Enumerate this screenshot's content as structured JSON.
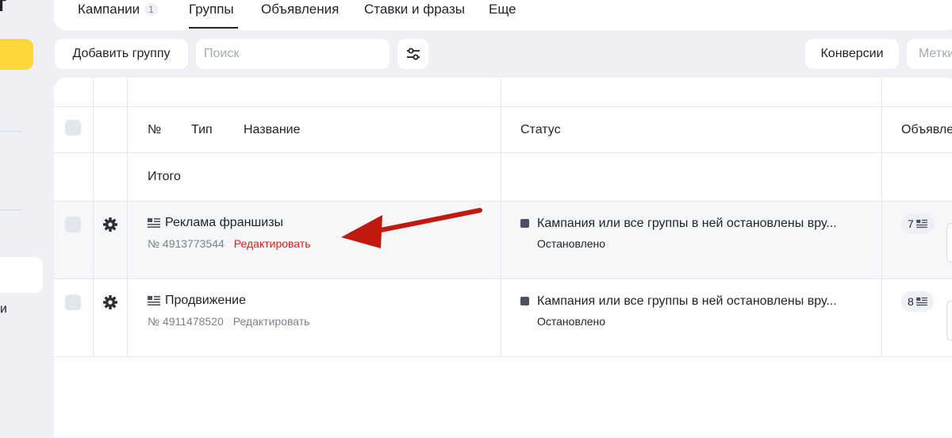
{
  "sidebar": {
    "logo_fragment": "ект",
    "item_tail": "и"
  },
  "tabs": [
    {
      "label": "Кампании",
      "count": "1"
    },
    {
      "label": "Группы"
    },
    {
      "label": "Объявления"
    },
    {
      "label": "Ставки и фразы"
    },
    {
      "label": "Еще"
    }
  ],
  "toolbar": {
    "add_group_label": "Добавить группу",
    "search_placeholder": "Поиск",
    "conversions_label": "Конверсии",
    "labels_label": "Метки"
  },
  "table": {
    "headers": {
      "number": "№",
      "type": "Тип",
      "name": "Название",
      "status": "Статус",
      "ads": "Объявле"
    },
    "total_label": "Итого",
    "rows": [
      {
        "name": "Реклама франшизы",
        "number": "№ 4913773544",
        "edit_label": "Редактировать",
        "status": "Кампания или все группы в ней остановлены вру...",
        "status_sub": "Остановлено",
        "ads_count": "7"
      },
      {
        "name": "Продвижение",
        "number": "№ 4911478520",
        "edit_label": "Редактировать",
        "status": "Кампания или все группы в ней остановлены вру...",
        "status_sub": "Остановлено",
        "ads_count": "8"
      }
    ]
  },
  "colors": {
    "accent_yellow": "#fcd839",
    "annotation_arrow": "#c0190f",
    "edit_highlight": "#e31d1d"
  }
}
